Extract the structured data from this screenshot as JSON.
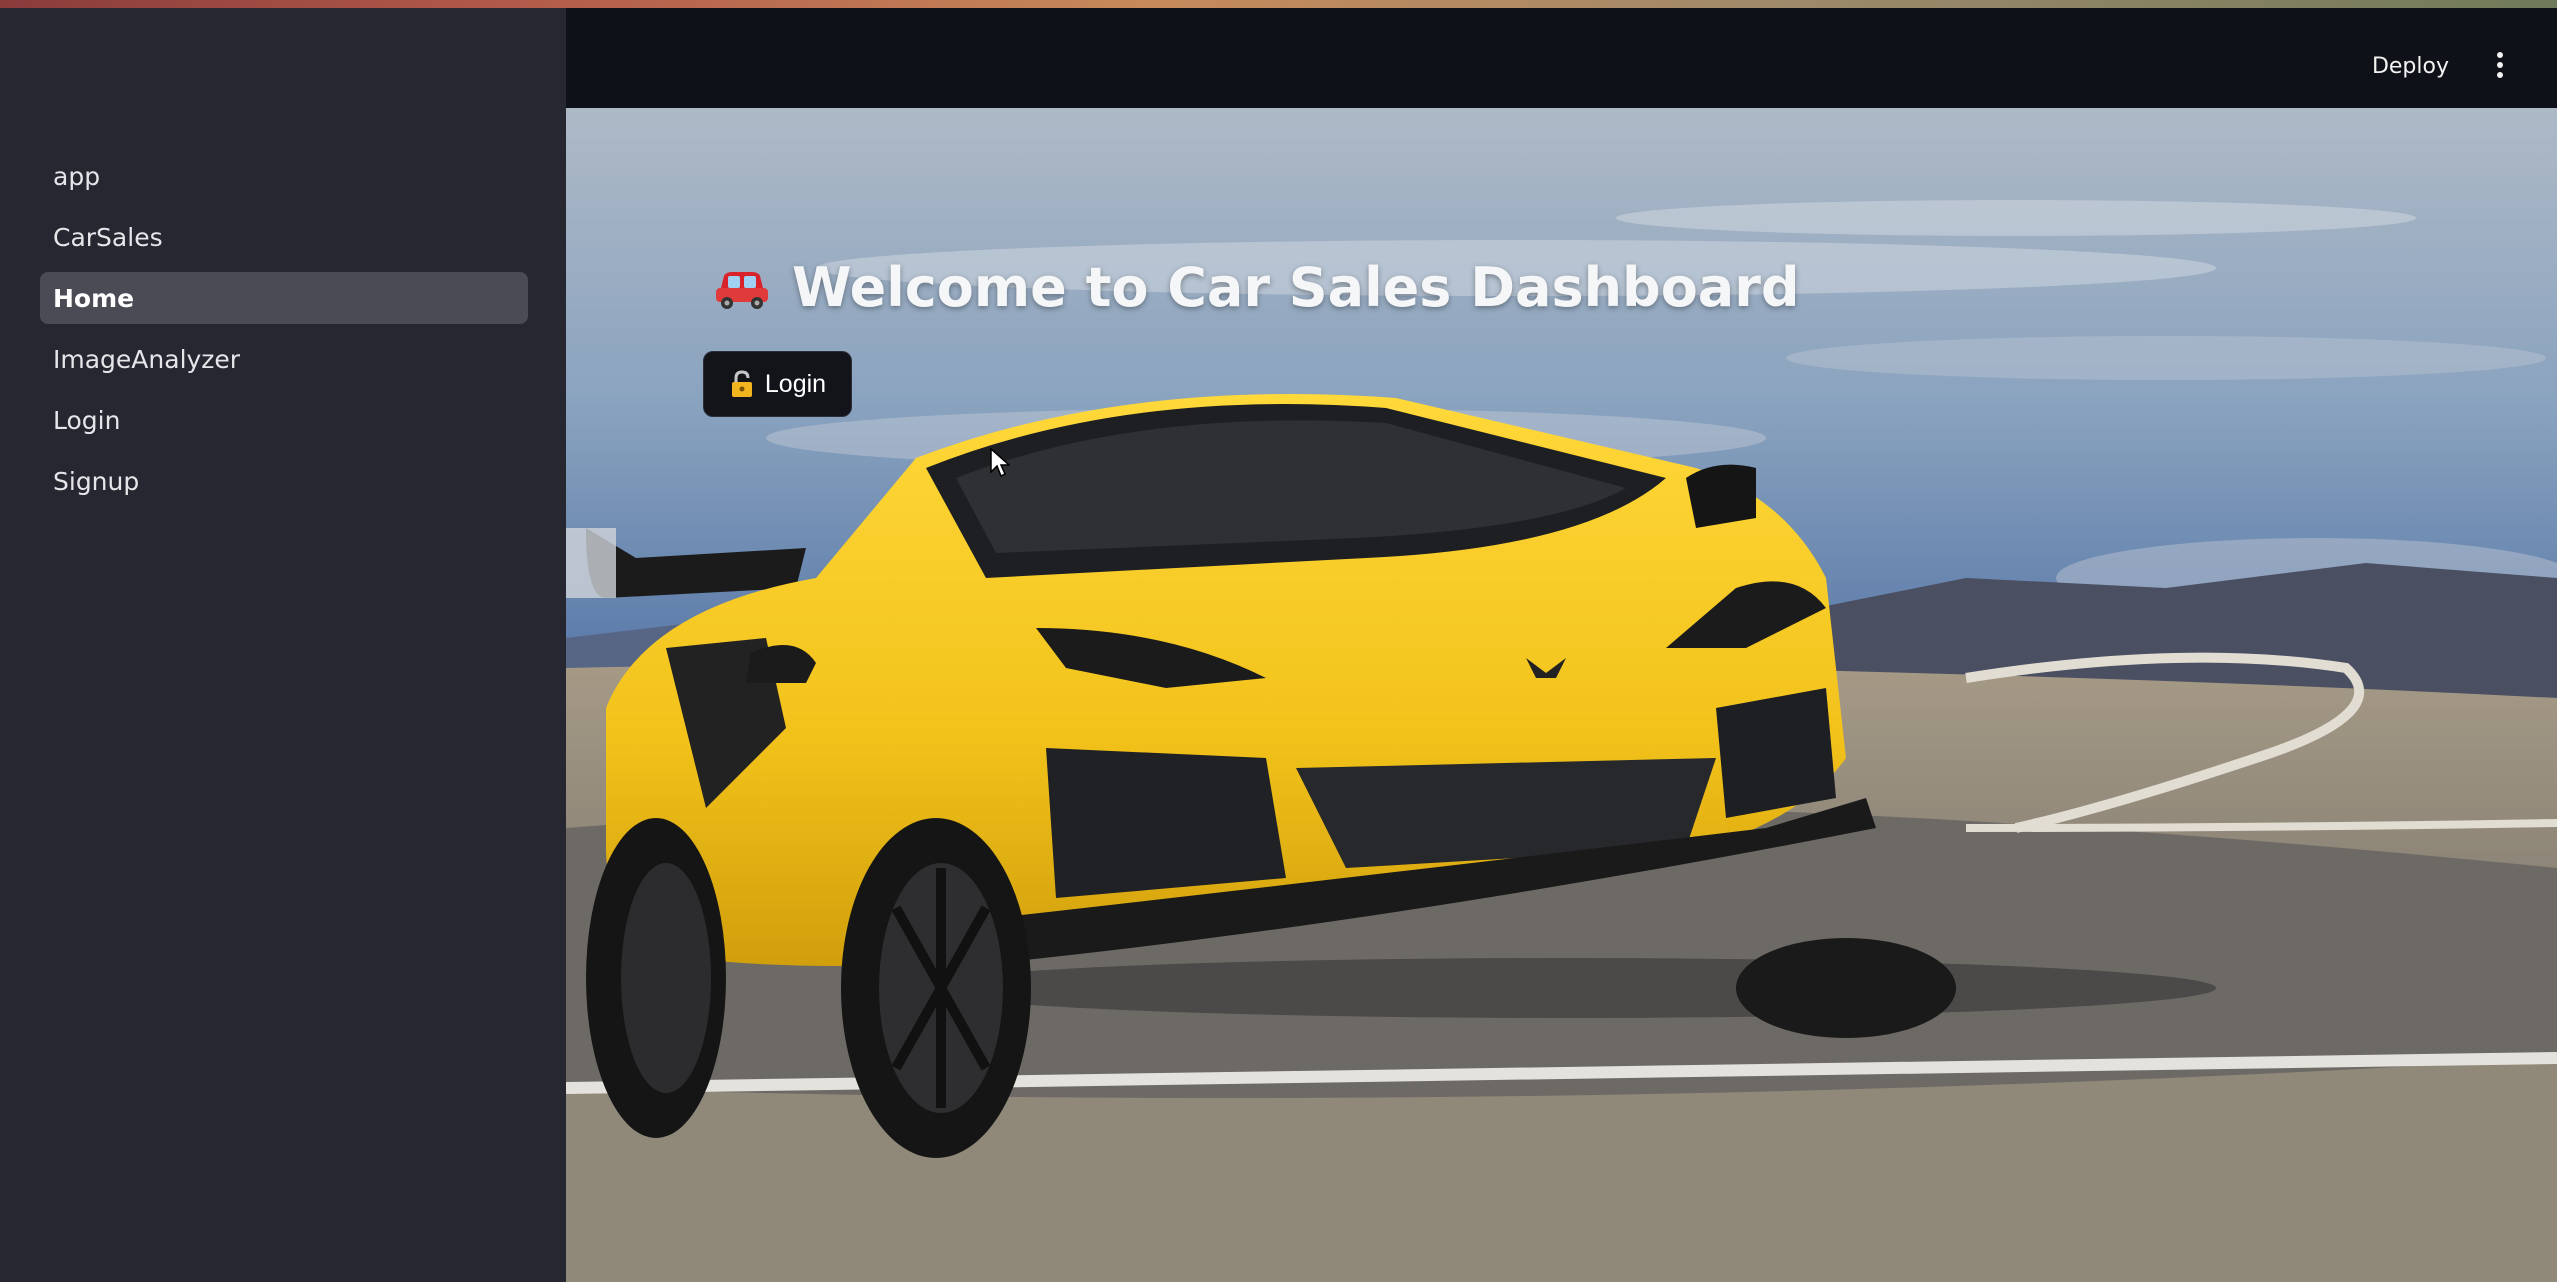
{
  "sidebar": {
    "items": [
      {
        "label": "app",
        "active": false
      },
      {
        "label": "CarSales",
        "active": false
      },
      {
        "label": "Home",
        "active": true
      },
      {
        "label": "ImageAnalyzer",
        "active": false
      },
      {
        "label": "Login",
        "active": false
      },
      {
        "label": "Signup",
        "active": false
      }
    ]
  },
  "header": {
    "deploy_label": "Deploy",
    "menu_icon": "kebab-menu-icon"
  },
  "main": {
    "title_icon": "red-car-icon",
    "title": "Welcome to Car Sales Dashboard",
    "login_button": {
      "icon": "lock-icon",
      "label": "Login"
    },
    "hero_image": "yellow-sports-car-photo"
  },
  "colors": {
    "sidebar_bg": "#262730",
    "app_bg": "#0e1117",
    "active_nav_bg": "#4a4b55",
    "car_yellow": "#f2c21a"
  }
}
